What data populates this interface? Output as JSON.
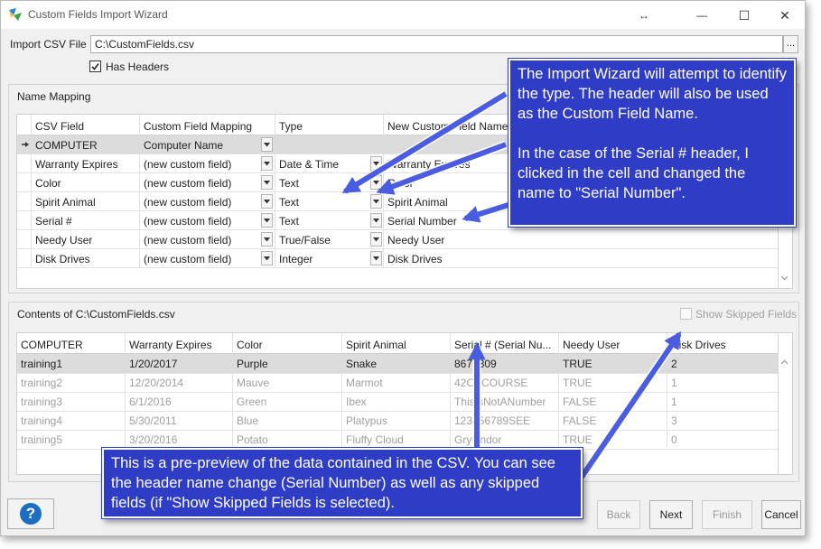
{
  "window": {
    "title": "Custom Fields Import Wizard",
    "resize_glyph": "↔",
    "minimize_glyph": "—",
    "maximize_glyph": "☐",
    "close_glyph": "✕"
  },
  "import": {
    "label": "Import CSV File",
    "value": "C:\\CustomFields.csv",
    "browse_label": "...",
    "has_headers_label": "Has Headers",
    "has_headers_checked": true
  },
  "mapping": {
    "group_title": "Name Mapping",
    "headers": [
      "CSV Field",
      "Custom Field Mapping",
      "Type",
      "New Custom Field Name"
    ],
    "rows": [
      {
        "field": "COMPUTER",
        "mapping": "Computer Name",
        "type": "",
        "name": ""
      },
      {
        "field": "Warranty Expires",
        "mapping": "(new custom field)",
        "type": "Date & Time",
        "name": "Warranty Expires"
      },
      {
        "field": "Color",
        "mapping": "(new custom field)",
        "type": "Text",
        "name": "Color"
      },
      {
        "field": "Spirit Animal",
        "mapping": "(new custom field)",
        "type": "Text",
        "name": "Spirit Animal"
      },
      {
        "field": "Serial #",
        "mapping": "(new custom field)",
        "type": "Text",
        "name": "Serial Number"
      },
      {
        "field": "Needy User",
        "mapping": "(new custom field)",
        "type": "True/False",
        "name": "Needy User"
      },
      {
        "field": "Disk Drives",
        "mapping": "(new custom field)",
        "type": "Integer",
        "name": "Disk Drives"
      }
    ]
  },
  "preview": {
    "group_title": "Contents of C:\\CustomFields.csv",
    "show_skipped_label": "Show Skipped Fields",
    "headers": [
      "COMPUTER",
      "Warranty Expires",
      "Color",
      "Spirit Animal",
      "Serial # (Serial Nu...",
      "Needy User",
      "Disk Drives"
    ],
    "rows": [
      [
        "training1",
        "1/20/2017",
        "Purple",
        "Snake",
        "8675309",
        "TRUE",
        "2"
      ],
      [
        "training2",
        "12/20/2014",
        "Mauve",
        "Marmot",
        "42OFCOURSE",
        "TRUE",
        "1"
      ],
      [
        "training3",
        "6/1/2016",
        "Green",
        "Ibex",
        "ThisIsNotANumber",
        "FALSE",
        "1"
      ],
      [
        "training4",
        "5/30/2011",
        "Blue",
        "Platypus",
        "123456789SEE",
        "FALSE",
        "3"
      ],
      [
        "training5",
        "3/20/2016",
        "Potato",
        "Fluffy Cloud",
        "Gryffindor",
        "TRUE",
        "0"
      ]
    ]
  },
  "buttons": {
    "help": "?",
    "back": "Back",
    "next": "Next",
    "finish": "Finish",
    "cancel": "Cancel"
  },
  "callouts": {
    "top_p1": "The Import Wizard will attempt to identify the type. The header will also be used as the Custom Field Name.",
    "top_p2": "In the case of the Serial # header, I clicked in the cell and changed the name to \"Serial Number\".",
    "bottom": "This is a pre-preview of the data contained in the CSV. You can see the header name change (Serial Number) as well as any skipped fields (if \"Show Skipped Fields is selected)."
  },
  "colors": {
    "callout_bg": "#2f3cc6",
    "arrow": "#4a5ce0",
    "help_button": "#1b6ec2"
  }
}
